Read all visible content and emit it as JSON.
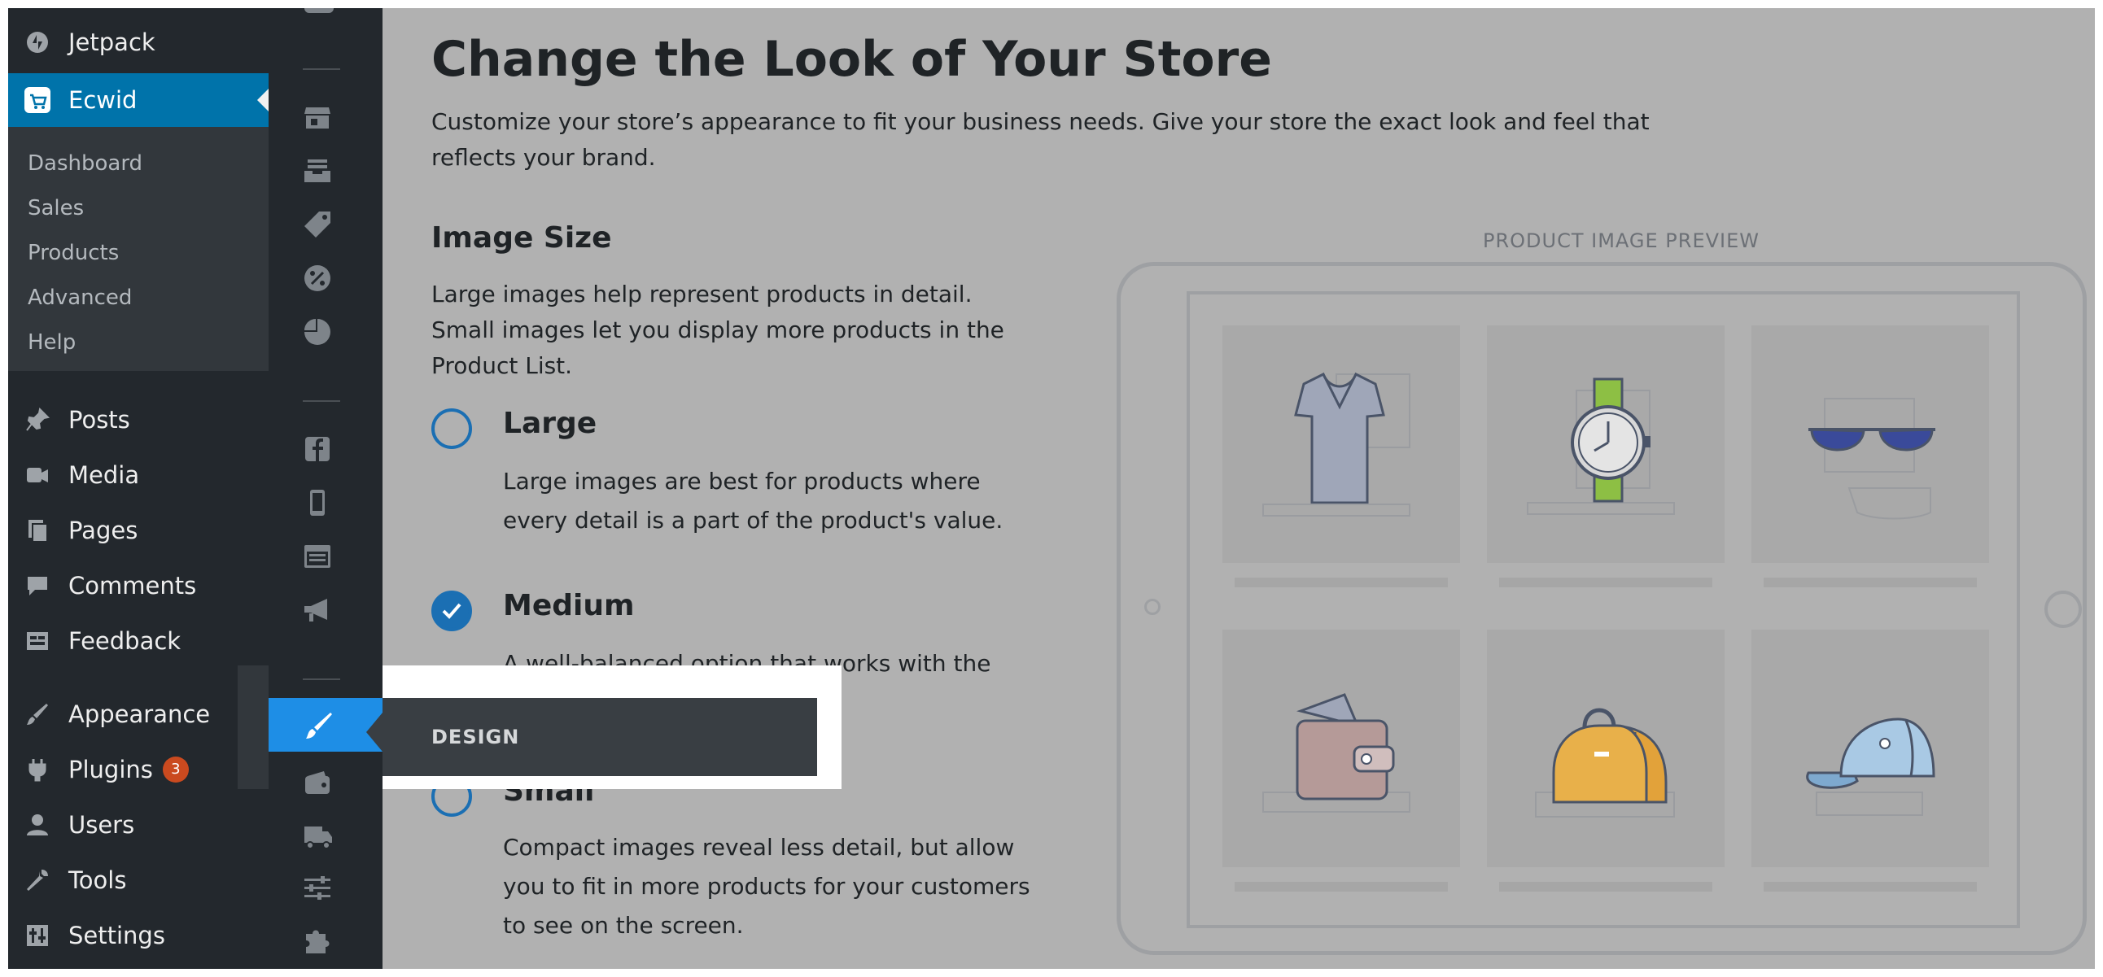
{
  "wp_sidebar": {
    "items": [
      {
        "label": "Jetpack",
        "icon": "jetpack-icon"
      },
      {
        "label": "Ecwid",
        "icon": "cart-icon"
      },
      {
        "label": "Posts",
        "icon": "pin-icon"
      },
      {
        "label": "Media",
        "icon": "media-icon"
      },
      {
        "label": "Pages",
        "icon": "pages-icon"
      },
      {
        "label": "Comments",
        "icon": "comments-icon"
      },
      {
        "label": "Feedback",
        "icon": "feedback-icon"
      },
      {
        "label": "Appearance",
        "icon": "brush-icon"
      },
      {
        "label": "Plugins",
        "icon": "plug-icon",
        "badge": "3"
      },
      {
        "label": "Users",
        "icon": "user-icon"
      },
      {
        "label": "Tools",
        "icon": "wrench-icon"
      },
      {
        "label": "Settings",
        "icon": "settings-icon"
      }
    ],
    "submenu": [
      "Dashboard",
      "Sales",
      "Products",
      "Advanced",
      "Help"
    ]
  },
  "tooltip": {
    "label": "DESIGN"
  },
  "page": {
    "title": "Change the Look of Your Store",
    "intro": "Customize your store’s appearance to fit your business needs. Give your store the exact look and feel that reflects your brand.",
    "section_title": "Image Size",
    "section_desc": "Large images help represent products in detail. Small images let you display more products in the Product List.",
    "options": [
      {
        "title": "Large",
        "desc": "Large images are best for products where every detail is a part of the product's value.",
        "checked": false
      },
      {
        "title": "Medium",
        "desc": "A well-balanced option that works with the majority of products.",
        "checked": true
      },
      {
        "title": "Small",
        "desc": "Compact images reveal less detail, but allow you to fit in more products for your customers to see on the screen.",
        "checked": false
      }
    ],
    "preview_label": "PRODUCT IMAGE PREVIEW",
    "products": [
      "t-shirt-icon",
      "watch-icon",
      "sunglasses-icon",
      "wallet-icon",
      "bag-icon",
      "cap-icon"
    ]
  },
  "colors": {
    "accent": "#0073aa",
    "ecwid_active": "#1e8ee6",
    "radio": "#1b6fb3",
    "badge": "#ca4a1f"
  }
}
